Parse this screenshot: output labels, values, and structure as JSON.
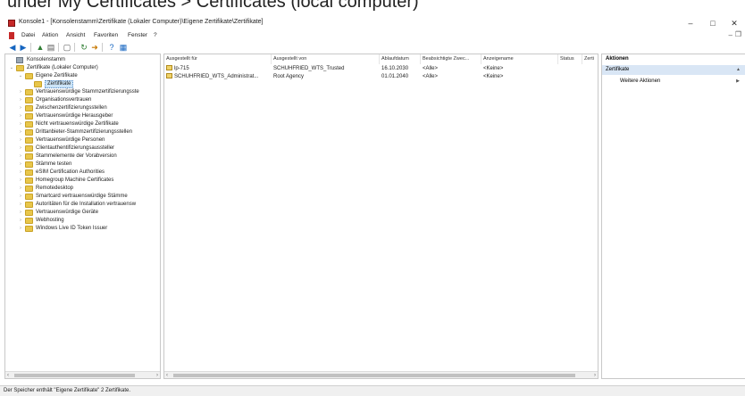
{
  "caption": "under My Certificates > Certificates (local computer)",
  "window": {
    "title": "Konsole1 - [Konsolenstamm\\Zertifikate (Lokaler Computer)\\Eigene Zertifikate\\Zertifikate]",
    "minimize": "–",
    "maximize": "□",
    "close": "✕"
  },
  "menu": [
    "Datei",
    "Aktion",
    "Ansicht",
    "Favoriten",
    "Fenster",
    "?"
  ],
  "inner_controls": {
    "minimize": "–",
    "restore": "❐"
  },
  "toolbar": [
    "back-icon",
    "forward-icon",
    "up-icon",
    "show-hide-tree-icon",
    "properties-icon",
    "refresh-icon",
    "export-list-icon",
    "help-icon",
    "mmc-icon"
  ],
  "tree": [
    {
      "label": "Konsolenstamm",
      "level": 0,
      "expander": "",
      "icon": "root",
      "selected": false
    },
    {
      "label": "Zertifikate (Lokaler Computer)",
      "level": 0,
      "expander": "v",
      "icon": "cert-store",
      "selected": false
    },
    {
      "label": "Eigene Zertifikate",
      "level": 1,
      "expander": "v",
      "icon": "folder",
      "selected": false
    },
    {
      "label": "Zertifikate",
      "level": 2,
      "expander": "",
      "icon": "folder",
      "selected": true
    },
    {
      "label": "Vertrauenswürdige Stammzertifizierungsste",
      "level": 1,
      "expander": ">",
      "icon": "folder",
      "selected": false
    },
    {
      "label": "Organisationsvertrauen",
      "level": 1,
      "expander": ">",
      "icon": "folder",
      "selected": false
    },
    {
      "label": "Zwischenzertifizierungsstellen",
      "level": 1,
      "expander": ">",
      "icon": "folder",
      "selected": false
    },
    {
      "label": "Vertrauenswürdige Herausgeber",
      "level": 1,
      "expander": ">",
      "icon": "folder",
      "selected": false
    },
    {
      "label": "Nicht vertrauenswürdige Zertifikate",
      "level": 1,
      "expander": ">",
      "icon": "folder",
      "selected": false
    },
    {
      "label": "Drittanbieter-Stammzertifizierungsstellen",
      "level": 1,
      "expander": ">",
      "icon": "folder",
      "selected": false
    },
    {
      "label": "Vertrauenswürdige Personen",
      "level": 1,
      "expander": ">",
      "icon": "folder",
      "selected": false
    },
    {
      "label": "Clientauthentifizierungsaussteller",
      "level": 1,
      "expander": ">",
      "icon": "folder",
      "selected": false
    },
    {
      "label": "Stammelemente der Vorabversion",
      "level": 1,
      "expander": ">",
      "icon": "folder",
      "selected": false
    },
    {
      "label": "Stämme testen",
      "level": 1,
      "expander": ">",
      "icon": "folder",
      "selected": false
    },
    {
      "label": "eSIM Certification Authorities",
      "level": 1,
      "expander": ">",
      "icon": "folder",
      "selected": false
    },
    {
      "label": "Homegroup Machine Certificates",
      "level": 1,
      "expander": ">",
      "icon": "folder",
      "selected": false
    },
    {
      "label": "Remotedesktop",
      "level": 1,
      "expander": ">",
      "icon": "folder",
      "selected": false
    },
    {
      "label": "Smartcard vertrauenswürdige Stämme",
      "level": 1,
      "expander": ">",
      "icon": "folder",
      "selected": false
    },
    {
      "label": "Autoritäten für die Installation vertrauensw",
      "level": 1,
      "expander": ">",
      "icon": "folder",
      "selected": false
    },
    {
      "label": "Vertrauenswürdige Geräte",
      "level": 1,
      "expander": ">",
      "icon": "folder",
      "selected": false
    },
    {
      "label": "Webhosting",
      "level": 1,
      "expander": ">",
      "icon": "folder",
      "selected": false
    },
    {
      "label": "Windows Live ID Token Issuer",
      "level": 1,
      "expander": ">",
      "icon": "folder",
      "selected": false
    }
  ],
  "list": {
    "columns": [
      "Ausgestellt für",
      "Ausgestellt von",
      "Ablaufdatum",
      "Beabsichtigte Zwec...",
      "Anzeigename",
      "Status",
      "Zerti"
    ],
    "rows": [
      [
        "lp-715",
        "SCHUHFRIED_WTS_Trusted",
        "16.10.2030",
        "<Alle>",
        "<Keine>",
        "",
        ""
      ],
      [
        "SCHUHFRIED_WTS_Administrat...",
        "Root Agency",
        "01.01.2040",
        "<Alle>",
        "<Keine>",
        "",
        ""
      ]
    ]
  },
  "actions": {
    "header": "Aktionen",
    "section": "Zertifikate",
    "items": [
      "Weitere Aktionen"
    ],
    "section_arrow": "▲",
    "item_arrow": "▶"
  },
  "scroll": {
    "left": "‹",
    "right": "›"
  },
  "status": "Der Speicher enthält \"Eigene Zertifikate\" 2 Zertifikate."
}
